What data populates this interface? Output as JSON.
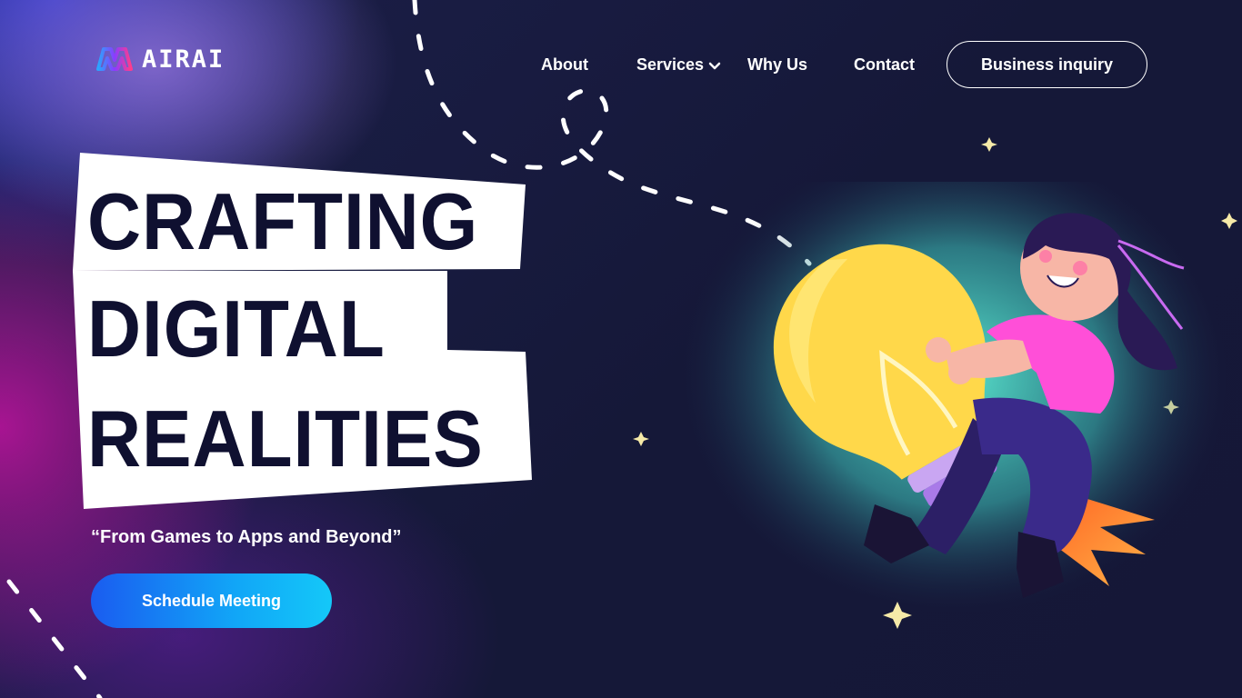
{
  "brand": {
    "name": "AIRAI"
  },
  "nav": {
    "items": [
      {
        "label": "About"
      },
      {
        "label": "Services"
      },
      {
        "label": "Why Us"
      },
      {
        "label": "Contact"
      }
    ],
    "cta_label": "Business inquiry"
  },
  "hero": {
    "title_lines": [
      "CRAFTING",
      "DIGITAL",
      "REALITIES"
    ],
    "tagline": "“From Games to Apps and Beyond”",
    "button_label": "Schedule Meeting"
  },
  "colors": {
    "title_text": "#0f1030",
    "cta_start": "#1a5cf0",
    "cta_end": "#14c8f8",
    "bulb": "#ffd84a",
    "glow": "#5ff0d6"
  },
  "icons": [
    "logo-mark-icon",
    "chevron-down-icon",
    "sparkle-star-icon",
    "girl-on-lightbulb-illustration"
  ]
}
